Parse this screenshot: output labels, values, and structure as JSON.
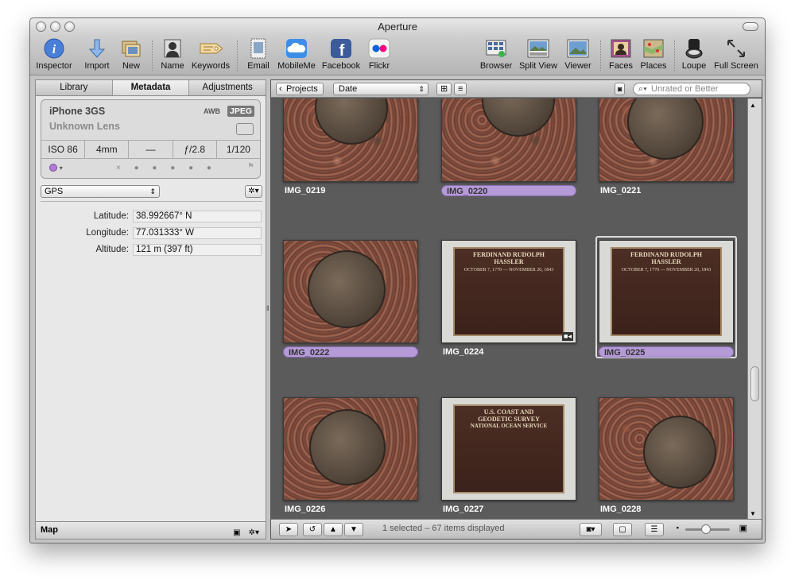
{
  "window": {
    "title": "Aperture"
  },
  "toolbar": {
    "items": [
      {
        "label": "Inspector"
      },
      {
        "label": "Import"
      },
      {
        "label": "New"
      },
      {
        "label": "Name"
      },
      {
        "label": "Keywords"
      },
      {
        "label": "Email"
      },
      {
        "label": "MobileMe"
      },
      {
        "label": "Facebook"
      },
      {
        "label": "Flickr"
      },
      {
        "label": "Browser"
      },
      {
        "label": "Split View"
      },
      {
        "label": "Viewer"
      },
      {
        "label": "Faces"
      },
      {
        "label": "Places"
      },
      {
        "label": "Loupe"
      },
      {
        "label": "Full Screen"
      }
    ]
  },
  "inspector": {
    "tabs": [
      "Library",
      "Metadata",
      "Adjustments"
    ],
    "active_tab": "Metadata",
    "camera": "iPhone 3GS",
    "lens": "Unknown Lens",
    "awb": "AWB",
    "format": "JPEG",
    "exif": [
      "ISO 86",
      "4mm",
      "—",
      "ƒ/2.8",
      "1/120"
    ],
    "rating": "× ● ● ● ● ●",
    "metadata_view": "GPS",
    "fields": [
      {
        "label": "Latitude:",
        "value": "38.992667° N"
      },
      {
        "label": "Longitude:",
        "value": "77.031333° W"
      },
      {
        "label": "Altitude:",
        "value": "121 m (397 ft)"
      }
    ],
    "map_label": "Map"
  },
  "browser": {
    "projects_button": "Projects",
    "sort": "Date",
    "search_placeholder": "Unrated or Better",
    "status": "1 selected – 67 items displayed",
    "thumbnails": [
      {
        "name": "IMG_0219",
        "selected": false
      },
      {
        "name": "IMG_0220",
        "selected": true
      },
      {
        "name": "IMG_0221",
        "selected": false
      },
      {
        "name": "IMG_0222",
        "selected": true
      },
      {
        "name": "IMG_0224",
        "selected": false
      },
      {
        "name": "IMG_0225",
        "selected": true
      },
      {
        "name": "IMG_0226",
        "selected": false
      },
      {
        "name": "IMG_0227",
        "selected": false
      },
      {
        "name": "IMG_0228",
        "selected": false
      }
    ],
    "plaque1": {
      "title1": "FERDINAND RUDOLPH",
      "title2": "HASSLER",
      "dates": "OCTOBER 7, 1770 — NOVEMBER 20, 1843"
    },
    "plaque2": {
      "title1": "U.S. COAST AND",
      "title2": "GEODETIC SURVEY",
      "title3": "NATIONAL OCEAN SERVICE"
    }
  }
}
